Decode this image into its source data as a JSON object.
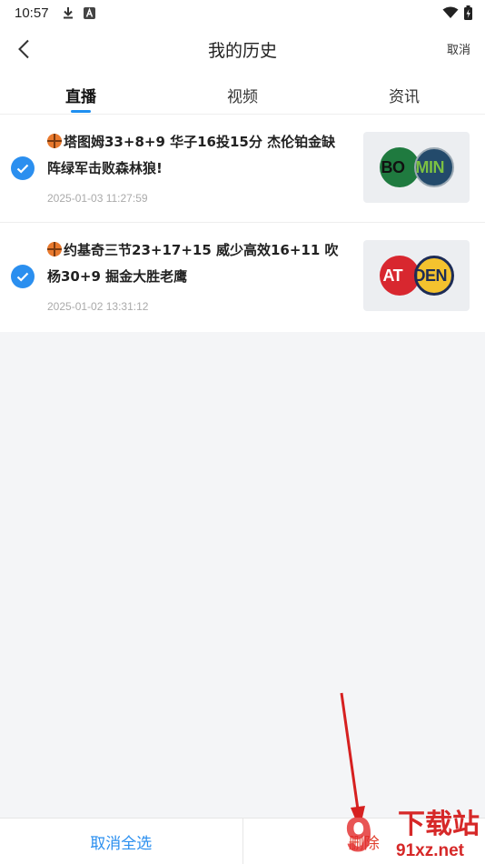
{
  "status_bar": {
    "time": "10:57"
  },
  "header": {
    "title": "我的历史",
    "cancel_label": "取消"
  },
  "tabs": [
    {
      "label": "直播",
      "active": true
    },
    {
      "label": "视频",
      "active": false
    },
    {
      "label": "资讯",
      "active": false
    }
  ],
  "items": [
    {
      "title": "塔图姆33+8+9 华子16投15分 杰伦铂金缺阵绿军击败森林狼!",
      "date": "2025-01-03 11:27:59",
      "team_left": "BO",
      "team_right": "MIN",
      "checked": true
    },
    {
      "title": "约基奇三节23+17+15 威少高效16+11 吹杨30+9 掘金大胜老鹰",
      "date": "2025-01-02 13:31:12",
      "team_left": "AT",
      "team_right": "DEN",
      "checked": true
    }
  ],
  "bottom": {
    "deselect_all_label": "取消全选",
    "delete_label": "删除"
  },
  "watermark": {
    "main": "下载站",
    "sub": "91xz.net",
    "digit": "9"
  },
  "colors": {
    "accent": "#2b8fef",
    "delete": "#e0412f"
  }
}
